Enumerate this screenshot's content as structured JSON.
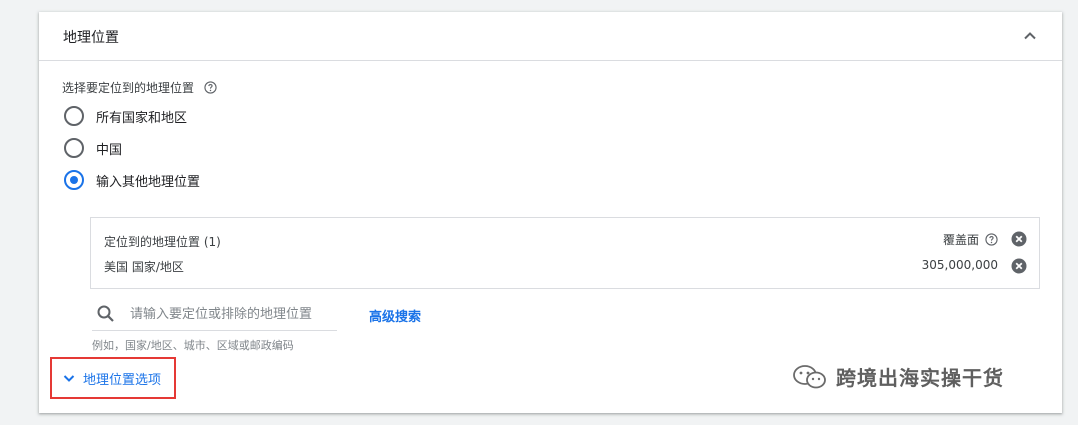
{
  "panel": {
    "title": "地理位置",
    "section_label": "选择要定位到的地理位置",
    "radio_options": [
      {
        "label": "所有国家和地区",
        "checked": false
      },
      {
        "label": "中国",
        "checked": false
      },
      {
        "label": "输入其他地理位置",
        "checked": true
      }
    ],
    "targeted": {
      "header": "定位到的地理位置 (1)",
      "reach_header": "覆盖面",
      "location_label": "美国 国家/地区",
      "reach_value": "305,000,000"
    },
    "search": {
      "placeholder": "请输入要定位或排除的地理位置",
      "hint": "例如，国家/地区、城市、区域或邮政编码",
      "advanced_link": "高级搜索"
    },
    "options_toggle_label": "地理位置选项"
  },
  "watermark": {
    "text": "跨境出海实操干货"
  },
  "colors": {
    "accent": "#1a73e8",
    "highlight_border": "#e53935"
  },
  "icons": [
    "chevron-up-icon",
    "help-icon",
    "close-circle-icon",
    "search-icon",
    "chevron-down-icon",
    "wechat-icon"
  ]
}
